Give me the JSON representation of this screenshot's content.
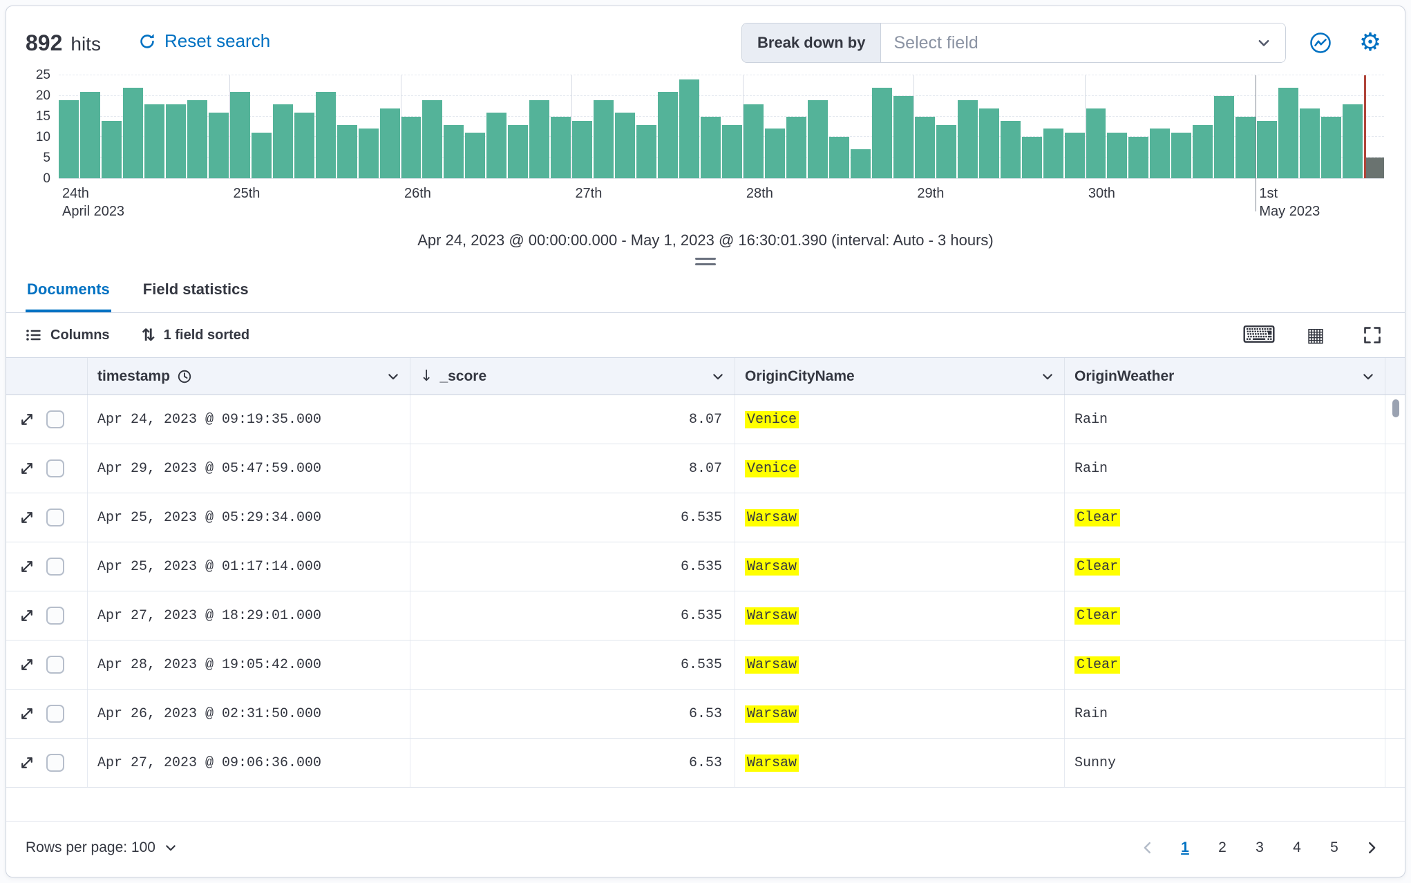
{
  "colors": {
    "accent_blue": "#0071C2",
    "bar_green": "#54B399",
    "highlight_yellow": "#FFFF00",
    "time_marker_red": "#B0453A"
  },
  "icons": {
    "gear": "⚙",
    "keyboard": "⌨",
    "grid": "▦",
    "sort": "⇅",
    "sort_desc": "↓"
  },
  "header": {
    "hits_count": "892",
    "hits_label": "hits",
    "reset_label": "Reset search",
    "breakdown_label": "Break down by",
    "breakdown_placeholder": "Select field"
  },
  "chart_data": {
    "type": "bar",
    "title": "Document count histogram",
    "interval": "3 hours",
    "ylim": [
      0,
      25
    ],
    "y_ticks": [
      0,
      5,
      10,
      15,
      20,
      25
    ],
    "values": [
      19,
      21,
      14,
      22,
      18,
      18,
      19,
      16,
      21,
      11,
      18,
      16,
      21,
      13,
      12,
      17,
      15,
      19,
      13,
      11,
      16,
      13,
      19,
      15,
      14,
      19,
      16,
      13,
      21,
      24,
      15,
      13,
      18,
      12,
      15,
      19,
      10,
      7,
      22,
      20,
      15,
      13,
      19,
      17,
      14,
      10,
      12,
      11,
      17,
      11,
      10,
      12,
      11,
      13,
      20,
      15,
      14,
      22,
      17,
      15,
      18,
      5
    ],
    "partial_last_bucket": true,
    "x_ticks": [
      {
        "index": 0,
        "line1": "24th",
        "line2": "April 2023",
        "emphasis": false
      },
      {
        "index": 8,
        "line1": "25th",
        "line2": "",
        "emphasis": false
      },
      {
        "index": 16,
        "line1": "26th",
        "line2": "",
        "emphasis": false
      },
      {
        "index": 24,
        "line1": "27th",
        "line2": "",
        "emphasis": false
      },
      {
        "index": 32,
        "line1": "28th",
        "line2": "",
        "emphasis": false
      },
      {
        "index": 40,
        "line1": "29th",
        "line2": "",
        "emphasis": false
      },
      {
        "index": 48,
        "line1": "30th",
        "line2": "",
        "emphasis": false
      },
      {
        "index": 56,
        "line1": "1st",
        "line2": "May 2023",
        "emphasis": true
      }
    ],
    "time_marker_fraction": 0.985
  },
  "caption": "Apr 24, 2023 @ 00:00:00.000 - May 1, 2023 @ 16:30:01.390 (interval: Auto - 3 hours)",
  "tabs": [
    {
      "label": "Documents"
    },
    {
      "label": "Field statistics"
    }
  ],
  "toolbar": {
    "columns_label": "Columns",
    "sorted_label": "1 field sorted"
  },
  "table": {
    "columns": {
      "timestamp": "timestamp",
      "score": "_score",
      "city": "OriginCityName",
      "weather": "OriginWeather"
    },
    "rows": [
      {
        "timestamp": "Apr 24, 2023 @ 09:19:35.000",
        "score": "8.07",
        "city": "Venice",
        "city_highlight": true,
        "weather": "Rain",
        "weather_highlight": false
      },
      {
        "timestamp": "Apr 29, 2023 @ 05:47:59.000",
        "score": "8.07",
        "city": "Venice",
        "city_highlight": true,
        "weather": "Rain",
        "weather_highlight": false
      },
      {
        "timestamp": "Apr 25, 2023 @ 05:29:34.000",
        "score": "6.535",
        "city": "Warsaw",
        "city_highlight": true,
        "weather": "Clear",
        "weather_highlight": true
      },
      {
        "timestamp": "Apr 25, 2023 @ 01:17:14.000",
        "score": "6.535",
        "city": "Warsaw",
        "city_highlight": true,
        "weather": "Clear",
        "weather_highlight": true
      },
      {
        "timestamp": "Apr 27, 2023 @ 18:29:01.000",
        "score": "6.535",
        "city": "Warsaw",
        "city_highlight": true,
        "weather": "Clear",
        "weather_highlight": true
      },
      {
        "timestamp": "Apr 28, 2023 @ 19:05:42.000",
        "score": "6.535",
        "city": "Warsaw",
        "city_highlight": true,
        "weather": "Clear",
        "weather_highlight": true
      },
      {
        "timestamp": "Apr 26, 2023 @ 02:31:50.000",
        "score": "6.53",
        "city": "Warsaw",
        "city_highlight": true,
        "weather": "Rain",
        "weather_highlight": false
      },
      {
        "timestamp": "Apr 27, 2023 @ 09:06:36.000",
        "score": "6.53",
        "city": "Warsaw",
        "city_highlight": true,
        "weather": "Sunny",
        "weather_highlight": false
      }
    ]
  },
  "footer": {
    "rows_per_page_label": "Rows per page: 100",
    "pages": [
      "1",
      "2",
      "3",
      "4",
      "5"
    ],
    "active_page": "1"
  }
}
